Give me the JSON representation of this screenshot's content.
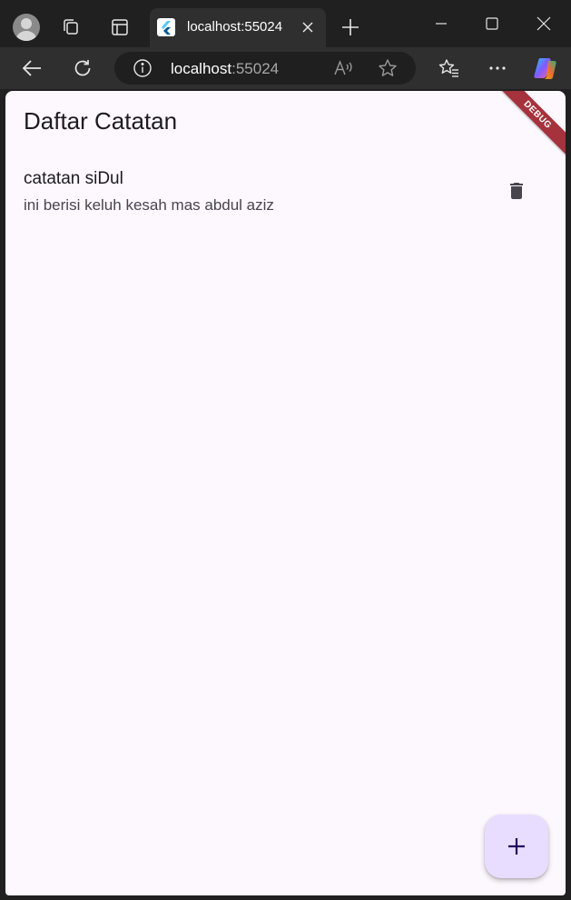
{
  "browser": {
    "tab": {
      "title": "localhost:55024"
    },
    "address_bar": {
      "host": "localhost",
      "port": ":55024"
    }
  },
  "app": {
    "title": "Daftar Catatan",
    "debug_banner": "DEBUG",
    "notes": [
      {
        "title": "catatan siDul",
        "content": "ini berisi keluh kesah mas abdul aziz"
      }
    ],
    "colors": {
      "background": "#fdf7fe",
      "fab_background": "#e9ddff",
      "fab_icon": "#21005d",
      "debug_banner": "#a5323c",
      "delete_icon": "#49454f"
    },
    "icons": {
      "delete": "trash-icon",
      "add": "plus-icon"
    }
  }
}
